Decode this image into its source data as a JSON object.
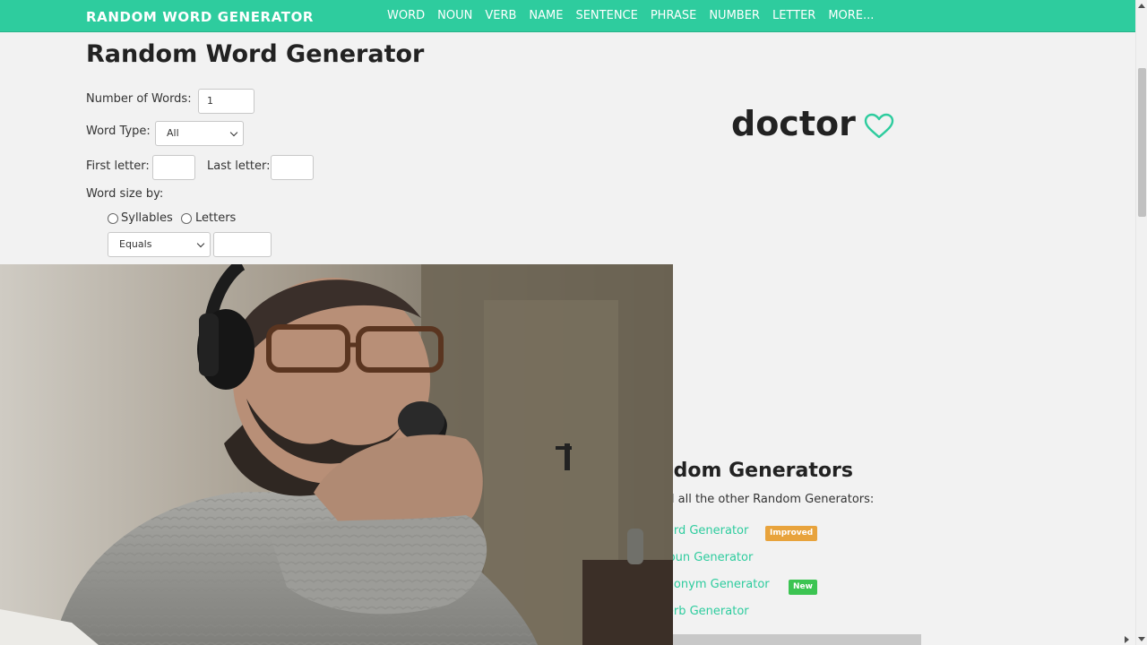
{
  "nav": {
    "brand": "RANDOM WORD GENERATOR",
    "links": [
      "WORD",
      "NOUN",
      "VERB",
      "NAME",
      "SENTENCE",
      "PHRASE",
      "NUMBER",
      "LETTER",
      "MORE..."
    ]
  },
  "form": {
    "title": "Random Word Generator",
    "num_words_label": "Number of Words:",
    "num_words_value": "1",
    "word_type_label": "Word Type:",
    "word_type_value": "All",
    "first_letter_label": "First letter:",
    "first_letter_value": "",
    "last_letter_label": "Last letter:",
    "last_letter_value": "",
    "word_size_label": "Word size by:",
    "syllables_label": "Syllables",
    "letters_label": "Letters",
    "size_compare_value": "Equals",
    "size_value": ""
  },
  "result": {
    "word": "doctor"
  },
  "generators": {
    "title": "ndom Generators",
    "description": "nd all the other Random Generators:",
    "items": [
      {
        "label": "Vord Generator",
        "badge": "Improved"
      },
      {
        "label": "Noun Generator",
        "badge": ""
      },
      {
        "label": "ynonym Generator",
        "badge": "New"
      },
      {
        "label": "Verb Generator",
        "badge": ""
      }
    ]
  },
  "colors": {
    "accent": "#2ecc9e",
    "badge_improved": "#e8a33c",
    "badge_new": "#3cc452"
  },
  "icons": {
    "favorite": "heart-outline-icon"
  }
}
